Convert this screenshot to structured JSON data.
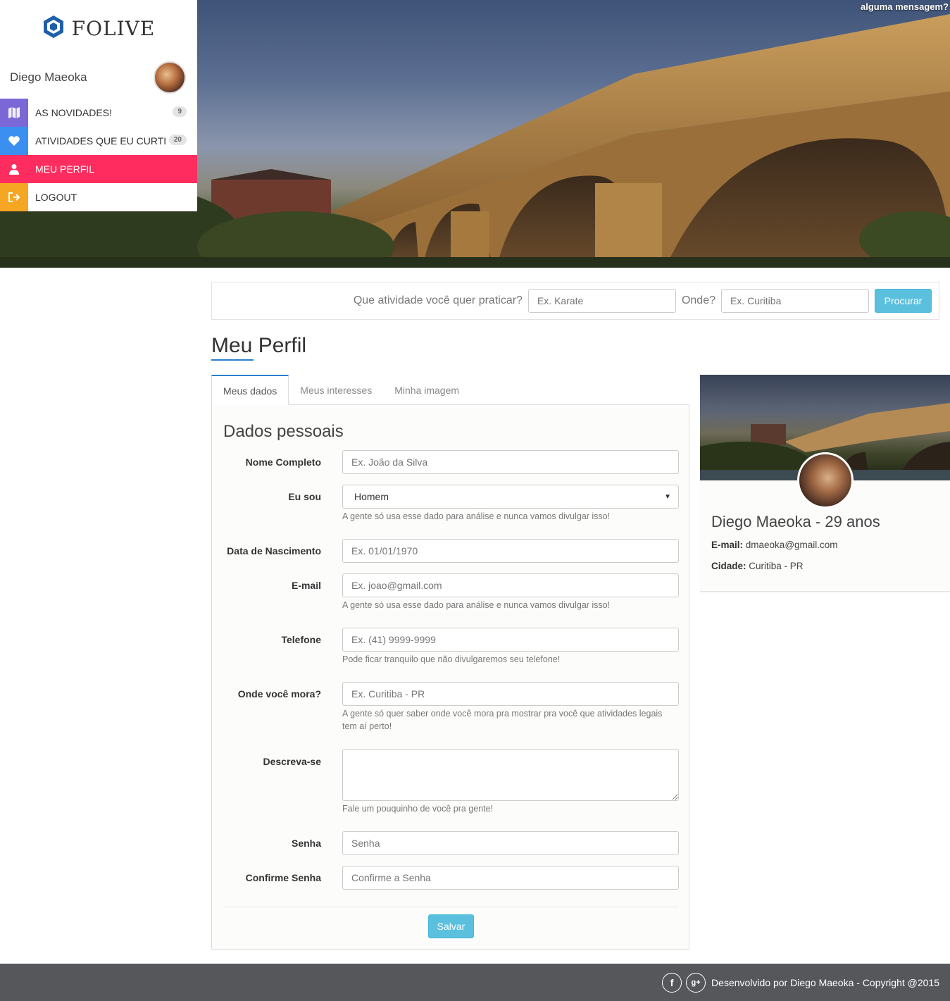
{
  "hero": {
    "message": "alguma mensagem?"
  },
  "sidebar": {
    "logo_text": "FOLIVE",
    "user_name": "Diego Maeoka",
    "items": [
      {
        "label": "AS NOVIDADES!",
        "badge": "9",
        "color": "#7b68d6",
        "icon": "map-icon"
      },
      {
        "label": "ATIVIDADES QUE EU CURTI",
        "badge": "20",
        "color": "#3a8ff0",
        "icon": "heart-icon"
      },
      {
        "label": "MEU PERFIL",
        "badge": "",
        "color": "#ff2d5f",
        "icon": "user-icon"
      },
      {
        "label": "LOGOUT",
        "badge": "",
        "color": "#f5a623",
        "icon": "logout-icon"
      }
    ]
  },
  "search": {
    "activity_label": "Que atividade você quer praticar?",
    "activity_placeholder": "Ex. Karate",
    "where_label": "Onde?",
    "where_placeholder": "Ex. Curitiba",
    "button": "Procurar"
  },
  "page": {
    "title": "Meu Perfil"
  },
  "tabs": [
    {
      "label": "Meus dados",
      "active": true
    },
    {
      "label": "Meus interesses",
      "active": false
    },
    {
      "label": "Minha imagem",
      "active": false
    }
  ],
  "form": {
    "section_title": "Dados pessoais",
    "name_label": "Nome Completo",
    "name_placeholder": "Ex. João da Silva",
    "gender_label": "Eu sou",
    "gender_value": "Homem",
    "gender_help": "A gente só usa esse dado para análise e nunca vamos divulgar isso!",
    "birth_label": "Data de Nascimento",
    "birth_placeholder": "Ex. 01/01/1970",
    "email_label": "E-mail",
    "email_placeholder": "Ex. joao@gmail.com",
    "email_help": "A gente só usa esse dado para análise e nunca vamos divulgar isso!",
    "phone_label": "Telefone",
    "phone_placeholder": "Ex. (41) 9999-9999",
    "phone_help": "Pode ficar tranquilo que não divulgaremos seu telefone!",
    "city_label": "Onde você mora?",
    "city_placeholder": "Ex. Curitiba - PR",
    "city_help": "A gente só quer saber onde você mora pra mostrar pra você que atividades legais tem aí perto!",
    "describe_label": "Descreva-se",
    "describe_help": "Fale um pouquinho de você pra gente!",
    "password_label": "Senha",
    "password_placeholder": "Senha",
    "confirm_label": "Confirme Senha",
    "confirm_placeholder": "Confirme a Senha",
    "save_button": "Salvar"
  },
  "profile_card": {
    "name": "Diego Maeoka - 29 anos",
    "email_label": "E-mail:",
    "email": "dmaeoka@gmail.com",
    "city_label": "Cidade:",
    "city": "Curitiba - PR"
  },
  "footer": {
    "text": "Desenvolvido por Diego Maeoka - Copyright @2015",
    "social": [
      "facebook-icon",
      "google-plus-icon"
    ]
  }
}
